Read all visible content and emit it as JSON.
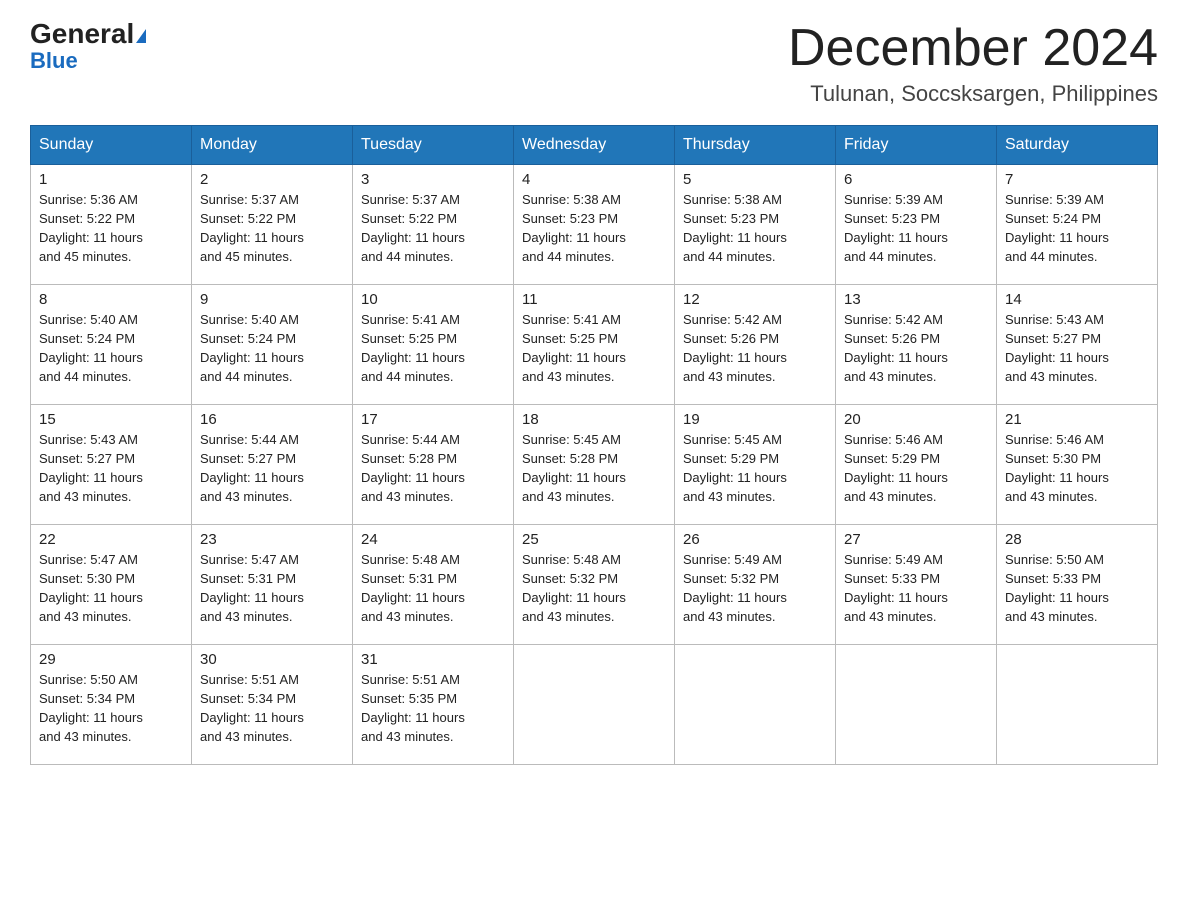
{
  "header": {
    "logo_general": "General",
    "logo_blue": "Blue",
    "month_title": "December 2024",
    "location": "Tulunan, Soccsksargen, Philippines"
  },
  "days_of_week": [
    "Sunday",
    "Monday",
    "Tuesday",
    "Wednesday",
    "Thursday",
    "Friday",
    "Saturday"
  ],
  "weeks": [
    [
      {
        "day": "1",
        "sunrise": "5:36 AM",
        "sunset": "5:22 PM",
        "daylight": "11 hours and 45 minutes."
      },
      {
        "day": "2",
        "sunrise": "5:37 AM",
        "sunset": "5:22 PM",
        "daylight": "11 hours and 45 minutes."
      },
      {
        "day": "3",
        "sunrise": "5:37 AM",
        "sunset": "5:22 PM",
        "daylight": "11 hours and 44 minutes."
      },
      {
        "day": "4",
        "sunrise": "5:38 AM",
        "sunset": "5:23 PM",
        "daylight": "11 hours and 44 minutes."
      },
      {
        "day": "5",
        "sunrise": "5:38 AM",
        "sunset": "5:23 PM",
        "daylight": "11 hours and 44 minutes."
      },
      {
        "day": "6",
        "sunrise": "5:39 AM",
        "sunset": "5:23 PM",
        "daylight": "11 hours and 44 minutes."
      },
      {
        "day": "7",
        "sunrise": "5:39 AM",
        "sunset": "5:24 PM",
        "daylight": "11 hours and 44 minutes."
      }
    ],
    [
      {
        "day": "8",
        "sunrise": "5:40 AM",
        "sunset": "5:24 PM",
        "daylight": "11 hours and 44 minutes."
      },
      {
        "day": "9",
        "sunrise": "5:40 AM",
        "sunset": "5:24 PM",
        "daylight": "11 hours and 44 minutes."
      },
      {
        "day": "10",
        "sunrise": "5:41 AM",
        "sunset": "5:25 PM",
        "daylight": "11 hours and 44 minutes."
      },
      {
        "day": "11",
        "sunrise": "5:41 AM",
        "sunset": "5:25 PM",
        "daylight": "11 hours and 43 minutes."
      },
      {
        "day": "12",
        "sunrise": "5:42 AM",
        "sunset": "5:26 PM",
        "daylight": "11 hours and 43 minutes."
      },
      {
        "day": "13",
        "sunrise": "5:42 AM",
        "sunset": "5:26 PM",
        "daylight": "11 hours and 43 minutes."
      },
      {
        "day": "14",
        "sunrise": "5:43 AM",
        "sunset": "5:27 PM",
        "daylight": "11 hours and 43 minutes."
      }
    ],
    [
      {
        "day": "15",
        "sunrise": "5:43 AM",
        "sunset": "5:27 PM",
        "daylight": "11 hours and 43 minutes."
      },
      {
        "day": "16",
        "sunrise": "5:44 AM",
        "sunset": "5:27 PM",
        "daylight": "11 hours and 43 minutes."
      },
      {
        "day": "17",
        "sunrise": "5:44 AM",
        "sunset": "5:28 PM",
        "daylight": "11 hours and 43 minutes."
      },
      {
        "day": "18",
        "sunrise": "5:45 AM",
        "sunset": "5:28 PM",
        "daylight": "11 hours and 43 minutes."
      },
      {
        "day": "19",
        "sunrise": "5:45 AM",
        "sunset": "5:29 PM",
        "daylight": "11 hours and 43 minutes."
      },
      {
        "day": "20",
        "sunrise": "5:46 AM",
        "sunset": "5:29 PM",
        "daylight": "11 hours and 43 minutes."
      },
      {
        "day": "21",
        "sunrise": "5:46 AM",
        "sunset": "5:30 PM",
        "daylight": "11 hours and 43 minutes."
      }
    ],
    [
      {
        "day": "22",
        "sunrise": "5:47 AM",
        "sunset": "5:30 PM",
        "daylight": "11 hours and 43 minutes."
      },
      {
        "day": "23",
        "sunrise": "5:47 AM",
        "sunset": "5:31 PM",
        "daylight": "11 hours and 43 minutes."
      },
      {
        "day": "24",
        "sunrise": "5:48 AM",
        "sunset": "5:31 PM",
        "daylight": "11 hours and 43 minutes."
      },
      {
        "day": "25",
        "sunrise": "5:48 AM",
        "sunset": "5:32 PM",
        "daylight": "11 hours and 43 minutes."
      },
      {
        "day": "26",
        "sunrise": "5:49 AM",
        "sunset": "5:32 PM",
        "daylight": "11 hours and 43 minutes."
      },
      {
        "day": "27",
        "sunrise": "5:49 AM",
        "sunset": "5:33 PM",
        "daylight": "11 hours and 43 minutes."
      },
      {
        "day": "28",
        "sunrise": "5:50 AM",
        "sunset": "5:33 PM",
        "daylight": "11 hours and 43 minutes."
      }
    ],
    [
      {
        "day": "29",
        "sunrise": "5:50 AM",
        "sunset": "5:34 PM",
        "daylight": "11 hours and 43 minutes."
      },
      {
        "day": "30",
        "sunrise": "5:51 AM",
        "sunset": "5:34 PM",
        "daylight": "11 hours and 43 minutes."
      },
      {
        "day": "31",
        "sunrise": "5:51 AM",
        "sunset": "5:35 PM",
        "daylight": "11 hours and 43 minutes."
      },
      null,
      null,
      null,
      null
    ]
  ],
  "labels": {
    "sunrise": "Sunrise:",
    "sunset": "Sunset:",
    "daylight": "Daylight:"
  }
}
